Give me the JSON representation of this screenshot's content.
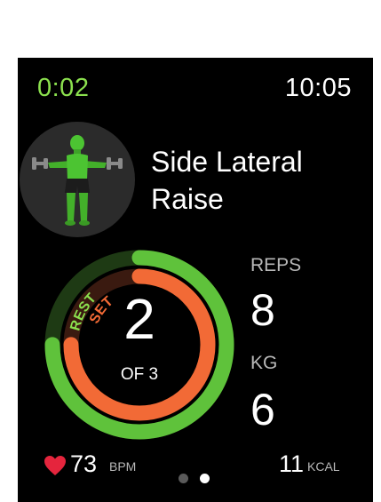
{
  "header": {
    "elapsed": "0:02",
    "clock": "10:05"
  },
  "exercise": {
    "avatar_icon": "lateral-raise-figure-icon",
    "name": "Side Lateral Raise"
  },
  "progress_ring": {
    "rest_label": "REST",
    "set_label": "SET",
    "rest_progress": 0.75,
    "set_progress": 0.75,
    "current_set": "2",
    "of_sets": "OF 3",
    "colors": {
      "rest": "#5fc23b",
      "rest_track": "#1e3a14",
      "set": "#f26a36",
      "set_track": "#3a1a10",
      "rest_text": "#8be04e",
      "set_text": "#f26a36"
    }
  },
  "stats": {
    "reps_label": "REPS",
    "reps_value": "8",
    "kg_label": "KG",
    "kg_value": "6"
  },
  "footer": {
    "heart_icon": "heart-icon",
    "heart_rate": "73",
    "heart_rate_unit": "BPM",
    "calories": "11",
    "calories_unit": "KCAL",
    "page_dots": 2,
    "active_page": 2
  }
}
